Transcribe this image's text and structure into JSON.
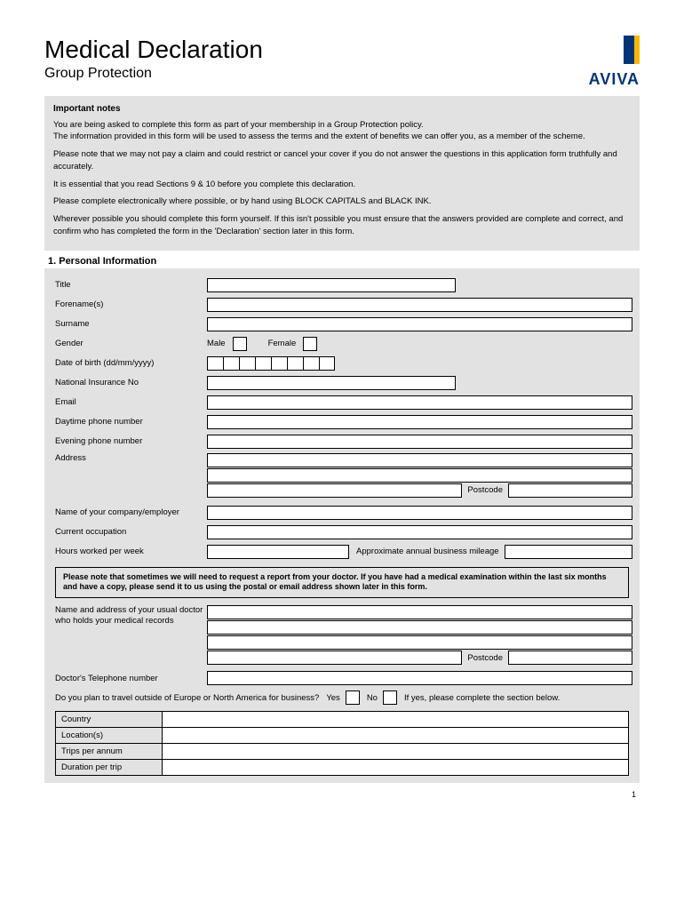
{
  "header": {
    "title": "Medical Declaration",
    "subtitle": "Group Protection",
    "brand": "AVIVA"
  },
  "notes": {
    "heading": "Important notes",
    "p1": "You are being asked to complete this form as part of your membership in a Group Protection policy.",
    "p2": "The information provided in this form will be used to assess the terms and the extent of benefits we can offer you, as a member of the scheme.",
    "p3": "Please note that we may not pay a claim and could restrict or cancel your cover if you do not answer the questions in this application form truthfully and accurately.",
    "p4": "It is essential that you read Sections 9 & 10 before you complete this declaration.",
    "p5": "Please complete electronically where possible, or by hand using BLOCK CAPITALS and BLACK INK.",
    "p6": "Wherever possible you should complete this form yourself. If this isn't possible you must ensure that the answers provided are complete and correct, and confirm who has completed the form in the 'Declaration' section later in this form."
  },
  "section1": {
    "title": "1. Personal Information",
    "labels": {
      "title_f": "Title",
      "forenames": "Forename(s)",
      "surname": "Surname",
      "gender": "Gender",
      "male": "Male",
      "female": "Female",
      "dob": "Date of birth (dd/mm/yyyy)",
      "ni": "National Insurance No",
      "email": "Email",
      "dayphone": "Daytime phone number",
      "evephone": "Evening phone number",
      "address": "Address",
      "postcode": "Postcode",
      "company": "Name of your company/employer",
      "occupation": "Current occupation",
      "hours": "Hours worked per week",
      "mileage": "Approximate annual business mileage"
    },
    "doctor_note": "Please note that sometimes we will need to request a report from your doctor. If you have had a medical examination within the last six months and have a copy, please send it to us using the postal or email address shown later in this form.",
    "doctor": {
      "name_addr": "Name and address of your usual doctor who holds your medical records",
      "phone": "Doctor's Telephone number"
    },
    "travel": {
      "question": "Do you plan to travel outside of Europe or North America for business?",
      "yes": "Yes",
      "no": "No",
      "ifyes": "If yes, please complete the section below.",
      "country": "Country",
      "locations": "Location(s)",
      "trips": "Trips per annum",
      "duration": "Duration per trip"
    }
  },
  "page_number": "1"
}
